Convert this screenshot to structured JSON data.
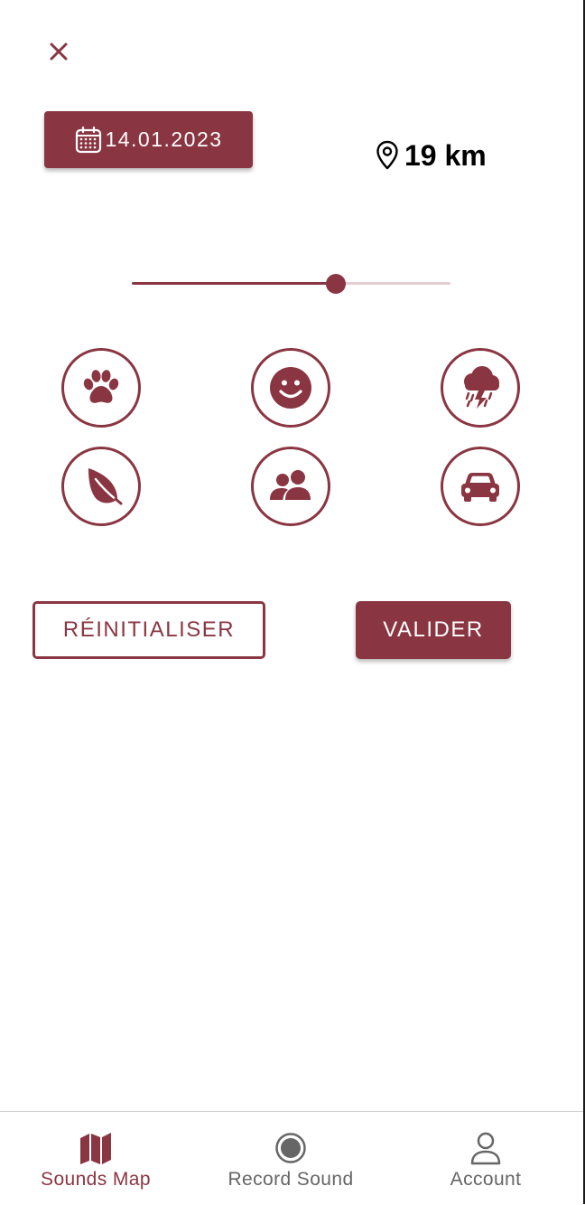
{
  "colors": {
    "accent": "#8a3642",
    "accent_light": "#e6cdd1",
    "inactive": "#666666"
  },
  "close": {
    "icon": "close-icon"
  },
  "date_button": {
    "icon": "calendar-icon",
    "label": "14.01.2023"
  },
  "distance": {
    "icon": "map-pin-icon",
    "value": "19 km"
  },
  "slider": {
    "level_fraction": 0.64
  },
  "categories": [
    {
      "icon": "paw-icon"
    },
    {
      "icon": "smiley-icon"
    },
    {
      "icon": "storm-cloud-icon"
    },
    {
      "icon": "leaf-icon"
    },
    {
      "icon": "people-icon"
    },
    {
      "icon": "car-icon"
    }
  ],
  "actions": {
    "reset_label": "RÉINITIALISER",
    "validate_label": "VALIDER"
  },
  "nav": {
    "active_index": 0,
    "items": [
      {
        "label": "Sounds Map",
        "icon": "map-icon"
      },
      {
        "label": "Record Sound",
        "icon": "record-icon"
      },
      {
        "label": "Account",
        "icon": "user-icon"
      }
    ]
  }
}
